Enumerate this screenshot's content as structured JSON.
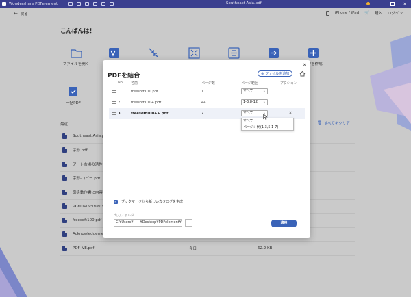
{
  "titlebar": {
    "app_name": "Wondershare PDFelement",
    "doc_title": "Southeast Asia.pdf"
  },
  "header": {
    "back_label": "戻る",
    "device_label": "iPhone / iPad",
    "purchase_label": "購入",
    "login_label": "ログイン"
  },
  "home": {
    "greeting": "こんばんは！",
    "tools": [
      {
        "label": "ファイルを開く"
      },
      {
        "label": "PDFを作成"
      },
      {
        "label": "一括PDF"
      }
    ],
    "recent_label": "最近",
    "clear_recent_label": "すべてをクリア",
    "files": [
      {
        "name": "Southeast Asia.pdf",
        "date": "",
        "size": ""
      },
      {
        "name": "字形.pdf",
        "date": "",
        "size": ""
      },
      {
        "name": "アート市場の活性化",
        "date": "",
        "size": ""
      },
      {
        "name": "字形-コピー.pdf",
        "date": "",
        "size": ""
      },
      {
        "name": "取扱動作書に内容",
        "date": "",
        "size": ""
      },
      {
        "name": "tatemono-reserv",
        "date": "",
        "size": ""
      },
      {
        "name": "freesoft100.pdf",
        "date": "",
        "size": ""
      },
      {
        "name": "Acknowledgemen",
        "date": "",
        "size": ""
      },
      {
        "name": "PDF_VE.pdf",
        "date": "今日",
        "size": "62.2 KB"
      }
    ]
  },
  "modal": {
    "title": "PDFを結合",
    "add_file_label": "ファイルを追加",
    "columns": {
      "no": "No.",
      "name": "名前",
      "pages": "ページ数",
      "range": "ページ範囲",
      "action": "アクション"
    },
    "rows": [
      {
        "no": "1",
        "name": "freesoft100.pdf",
        "pages": "1",
        "range": "すべて"
      },
      {
        "no": "2",
        "name": "freesoft100+.pdf",
        "pages": "44",
        "range": "1-3,8-12"
      },
      {
        "no": "3",
        "name": "freesoft100++.pdf",
        "pages": "7",
        "range": "すべて"
      }
    ],
    "dropdown_options": [
      "すべて",
      "ページ：例(1,3,5,1-7)"
    ],
    "bookmark_label": "ブックマークから新しいカタログを生成",
    "output_folder_label": "出力フォルダ",
    "output_path": "C:¥Users¥　　¥Desktop¥PDFelement¥C",
    "browse_label": "…",
    "apply_label": "適用"
  }
}
